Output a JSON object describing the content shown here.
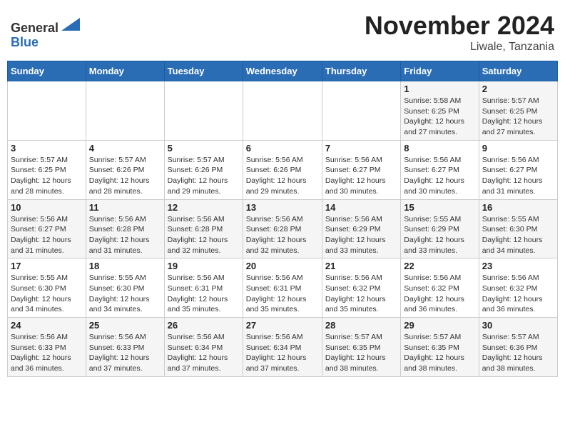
{
  "header": {
    "logo_line1": "General",
    "logo_line2": "Blue",
    "month": "November 2024",
    "location": "Liwale, Tanzania"
  },
  "weekdays": [
    "Sunday",
    "Monday",
    "Tuesday",
    "Wednesday",
    "Thursday",
    "Friday",
    "Saturday"
  ],
  "weeks": [
    [
      {
        "day": "",
        "info": ""
      },
      {
        "day": "",
        "info": ""
      },
      {
        "day": "",
        "info": ""
      },
      {
        "day": "",
        "info": ""
      },
      {
        "day": "",
        "info": ""
      },
      {
        "day": "1",
        "info": "Sunrise: 5:58 AM\nSunset: 6:25 PM\nDaylight: 12 hours\nand 27 minutes."
      },
      {
        "day": "2",
        "info": "Sunrise: 5:57 AM\nSunset: 6:25 PM\nDaylight: 12 hours\nand 27 minutes."
      }
    ],
    [
      {
        "day": "3",
        "info": "Sunrise: 5:57 AM\nSunset: 6:25 PM\nDaylight: 12 hours\nand 28 minutes."
      },
      {
        "day": "4",
        "info": "Sunrise: 5:57 AM\nSunset: 6:26 PM\nDaylight: 12 hours\nand 28 minutes."
      },
      {
        "day": "5",
        "info": "Sunrise: 5:57 AM\nSunset: 6:26 PM\nDaylight: 12 hours\nand 29 minutes."
      },
      {
        "day": "6",
        "info": "Sunrise: 5:56 AM\nSunset: 6:26 PM\nDaylight: 12 hours\nand 29 minutes."
      },
      {
        "day": "7",
        "info": "Sunrise: 5:56 AM\nSunset: 6:27 PM\nDaylight: 12 hours\nand 30 minutes."
      },
      {
        "day": "8",
        "info": "Sunrise: 5:56 AM\nSunset: 6:27 PM\nDaylight: 12 hours\nand 30 minutes."
      },
      {
        "day": "9",
        "info": "Sunrise: 5:56 AM\nSunset: 6:27 PM\nDaylight: 12 hours\nand 31 minutes."
      }
    ],
    [
      {
        "day": "10",
        "info": "Sunrise: 5:56 AM\nSunset: 6:27 PM\nDaylight: 12 hours\nand 31 minutes."
      },
      {
        "day": "11",
        "info": "Sunrise: 5:56 AM\nSunset: 6:28 PM\nDaylight: 12 hours\nand 31 minutes."
      },
      {
        "day": "12",
        "info": "Sunrise: 5:56 AM\nSunset: 6:28 PM\nDaylight: 12 hours\nand 32 minutes."
      },
      {
        "day": "13",
        "info": "Sunrise: 5:56 AM\nSunset: 6:28 PM\nDaylight: 12 hours\nand 32 minutes."
      },
      {
        "day": "14",
        "info": "Sunrise: 5:56 AM\nSunset: 6:29 PM\nDaylight: 12 hours\nand 33 minutes."
      },
      {
        "day": "15",
        "info": "Sunrise: 5:55 AM\nSunset: 6:29 PM\nDaylight: 12 hours\nand 33 minutes."
      },
      {
        "day": "16",
        "info": "Sunrise: 5:55 AM\nSunset: 6:30 PM\nDaylight: 12 hours\nand 34 minutes."
      }
    ],
    [
      {
        "day": "17",
        "info": "Sunrise: 5:55 AM\nSunset: 6:30 PM\nDaylight: 12 hours\nand 34 minutes."
      },
      {
        "day": "18",
        "info": "Sunrise: 5:55 AM\nSunset: 6:30 PM\nDaylight: 12 hours\nand 34 minutes."
      },
      {
        "day": "19",
        "info": "Sunrise: 5:56 AM\nSunset: 6:31 PM\nDaylight: 12 hours\nand 35 minutes."
      },
      {
        "day": "20",
        "info": "Sunrise: 5:56 AM\nSunset: 6:31 PM\nDaylight: 12 hours\nand 35 minutes."
      },
      {
        "day": "21",
        "info": "Sunrise: 5:56 AM\nSunset: 6:32 PM\nDaylight: 12 hours\nand 35 minutes."
      },
      {
        "day": "22",
        "info": "Sunrise: 5:56 AM\nSunset: 6:32 PM\nDaylight: 12 hours\nand 36 minutes."
      },
      {
        "day": "23",
        "info": "Sunrise: 5:56 AM\nSunset: 6:32 PM\nDaylight: 12 hours\nand 36 minutes."
      }
    ],
    [
      {
        "day": "24",
        "info": "Sunrise: 5:56 AM\nSunset: 6:33 PM\nDaylight: 12 hours\nand 36 minutes."
      },
      {
        "day": "25",
        "info": "Sunrise: 5:56 AM\nSunset: 6:33 PM\nDaylight: 12 hours\nand 37 minutes."
      },
      {
        "day": "26",
        "info": "Sunrise: 5:56 AM\nSunset: 6:34 PM\nDaylight: 12 hours\nand 37 minutes."
      },
      {
        "day": "27",
        "info": "Sunrise: 5:56 AM\nSunset: 6:34 PM\nDaylight: 12 hours\nand 37 minutes."
      },
      {
        "day": "28",
        "info": "Sunrise: 5:57 AM\nSunset: 6:35 PM\nDaylight: 12 hours\nand 38 minutes."
      },
      {
        "day": "29",
        "info": "Sunrise: 5:57 AM\nSunset: 6:35 PM\nDaylight: 12 hours\nand 38 minutes."
      },
      {
        "day": "30",
        "info": "Sunrise: 5:57 AM\nSunset: 6:36 PM\nDaylight: 12 hours\nand 38 minutes."
      }
    ]
  ]
}
